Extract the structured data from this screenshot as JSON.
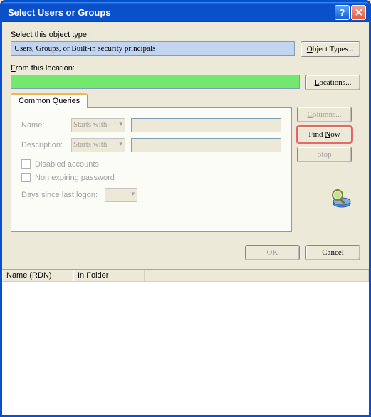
{
  "title": "Select Users or Groups",
  "section1": {
    "label": "Select this object type:",
    "value": "Users, Groups, or Built-in security principals",
    "button": "Object Types..."
  },
  "section2": {
    "label": "From this location:",
    "value": "",
    "button": "Locations..."
  },
  "tab": {
    "label": "Common Queries"
  },
  "queries": {
    "name_label": "Name:",
    "name_mode": "Starts with",
    "desc_label": "Description:",
    "desc_mode": "Starts with",
    "chk_disabled": "Disabled accounts",
    "chk_nonexp": "Non expiring password",
    "days_label": "Days since last logon:"
  },
  "sidebar": {
    "columns": "Columns...",
    "find": "Find Now",
    "stop": "Stop"
  },
  "bottom": {
    "ok": "OK",
    "cancel": "Cancel"
  },
  "results": {
    "col1": "Name (RDN)",
    "col2": "In Folder"
  }
}
